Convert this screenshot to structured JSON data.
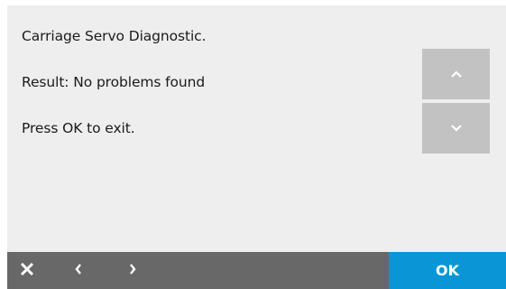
{
  "message": {
    "line1": "Carriage Servo Diagnostic.",
    "line2": "Result: No problems found",
    "line3": "Press OK to exit."
  },
  "scroll": {
    "up_icon": "chevron-up-icon",
    "down_icon": "chevron-down-icon"
  },
  "navbar": {
    "close_icon": "close-icon",
    "back_icon": "chevron-left-icon",
    "forward_icon": "chevron-right-icon",
    "ok_label": "OK"
  },
  "colors": {
    "screen_background": "#eeeeee",
    "scroll_button": "#c2c2c2",
    "bottom_bar": "#686868",
    "ok_button": "#0a96d6",
    "text": "#1a1a1a"
  }
}
